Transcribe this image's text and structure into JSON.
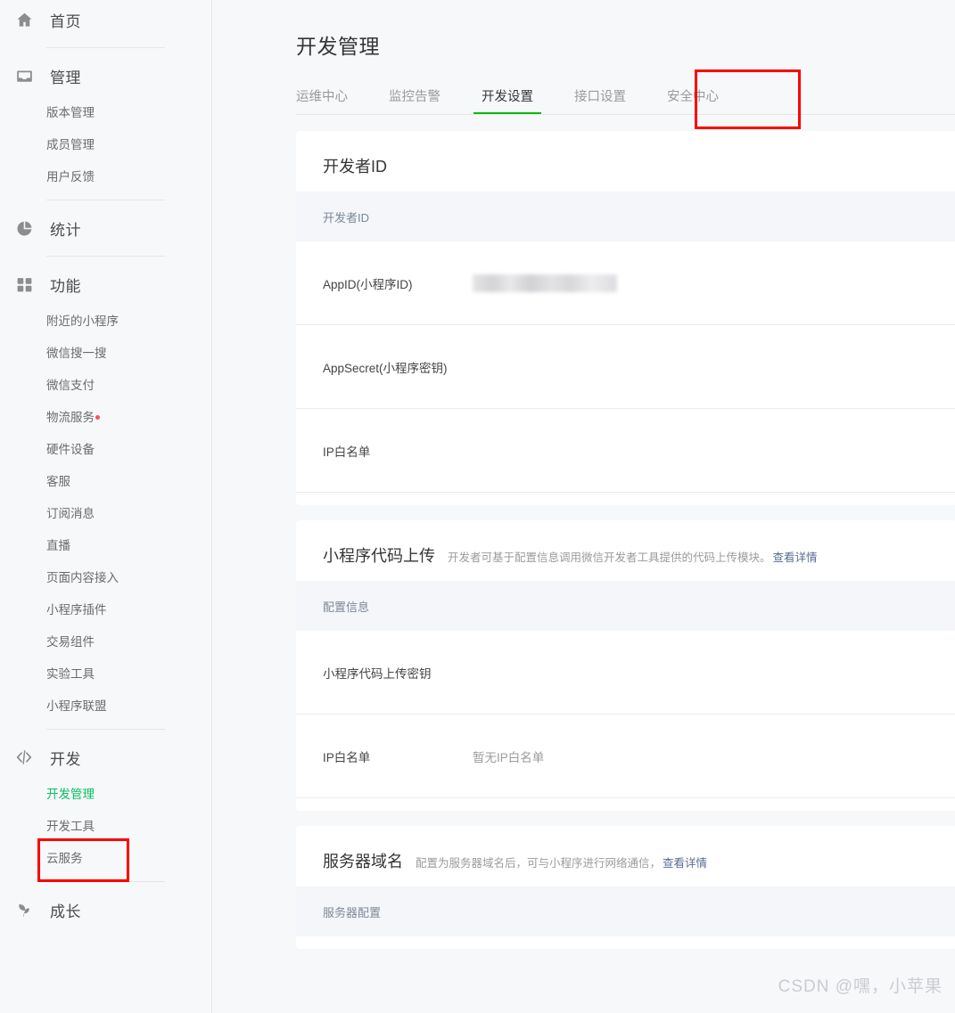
{
  "sidebar": {
    "groups": [
      {
        "icon": "home-icon",
        "label": "首页",
        "items": []
      },
      {
        "icon": "inbox-icon",
        "label": "管理",
        "items": [
          {
            "label": "版本管理"
          },
          {
            "label": "成员管理"
          },
          {
            "label": "用户反馈"
          }
        ]
      },
      {
        "icon": "pie-chart-icon",
        "label": "统计",
        "items": []
      },
      {
        "icon": "grid-icon",
        "label": "功能",
        "items": [
          {
            "label": "附近的小程序"
          },
          {
            "label": "微信搜一搜"
          },
          {
            "label": "微信支付"
          },
          {
            "label": "物流服务",
            "badge": true
          },
          {
            "label": "硬件设备"
          },
          {
            "label": "客服"
          },
          {
            "label": "订阅消息"
          },
          {
            "label": "直播"
          },
          {
            "label": "页面内容接入"
          },
          {
            "label": "小程序插件"
          },
          {
            "label": "交易组件"
          },
          {
            "label": "实验工具"
          },
          {
            "label": "小程序联盟"
          }
        ]
      },
      {
        "icon": "code-icon",
        "label": "开发",
        "items": [
          {
            "label": "开发管理",
            "active": true
          },
          {
            "label": "开发工具"
          },
          {
            "label": "云服务"
          }
        ]
      },
      {
        "icon": "sprout-icon",
        "label": "成长",
        "items": []
      }
    ]
  },
  "header": {
    "title": "开发管理"
  },
  "tabs": [
    {
      "label": "运维中心"
    },
    {
      "label": "监控告警"
    },
    {
      "label": "开发设置",
      "active": true
    },
    {
      "label": "接口设置"
    },
    {
      "label": "安全中心"
    }
  ],
  "cards": [
    {
      "title": "开发者ID",
      "desc": "",
      "link": "",
      "rows": [
        {
          "label": "开发者ID",
          "value": "",
          "type": "header"
        },
        {
          "label": "AppID(小程序ID)",
          "value": "",
          "type": "redacted"
        },
        {
          "label": "AppSecret(小程序密钥)",
          "value": "",
          "type": "normal"
        },
        {
          "label": "IP白名单",
          "value": "",
          "type": "normal"
        }
      ]
    },
    {
      "title": "小程序代码上传",
      "desc": "开发者可基于配置信息调用微信开发者工具提供的代码上传模块。",
      "link": "查看详情",
      "rows": [
        {
          "label": "配置信息",
          "value": "",
          "type": "header"
        },
        {
          "label": "小程序代码上传密钥",
          "value": "",
          "type": "normal"
        },
        {
          "label": "IP白名单",
          "value": "暂无IP白名单",
          "type": "normal"
        }
      ]
    },
    {
      "title": "服务器域名",
      "desc": "配置为服务器域名后，可与小程序进行网络通信，",
      "link": "查看详情",
      "rows": [
        {
          "label": "服务器配置",
          "value": "",
          "type": "header"
        }
      ]
    }
  ],
  "annotations": {
    "tab_box_color": "#ff0000",
    "sidebar_box_color": "#ff0000",
    "active_tab_underline_color": "#09bb07",
    "active_sidebar_text_color": "#07c160"
  },
  "watermark": {
    "text": "CSDN @嘿，小苹果"
  }
}
